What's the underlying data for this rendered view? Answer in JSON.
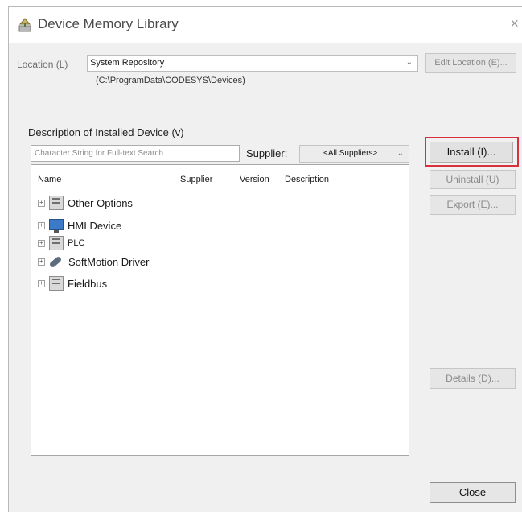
{
  "window": {
    "title": "Device Memory Library",
    "close_glyph": "×"
  },
  "location": {
    "label": "Location (L)",
    "value": "System Repository",
    "path": "(C:\\ProgramData\\CODESYS\\Devices)",
    "edit_button": "Edit Location (E)..."
  },
  "installed": {
    "label": "Description of Installed Device (v)",
    "search_placeholder": "Character String for Full-text Search",
    "supplier_label": "Supplier:",
    "supplier_value": "<All Suppliers>"
  },
  "columns": [
    "Name",
    "Supplier",
    "Version",
    "Description"
  ],
  "tree": [
    {
      "label": "Other Options",
      "icon": "cabinet-icon"
    },
    {
      "label": "HMI Device",
      "icon": "monitor-icon"
    },
    {
      "label": "PLC",
      "icon": "cabinet-icon"
    },
    {
      "label": "SoftMotion Driver",
      "icon": "drive-icon"
    },
    {
      "label": "Fieldbus",
      "icon": "cabinet-icon"
    }
  ],
  "buttons": {
    "install": "Install (I)...",
    "uninstall": "Uninstall (U)",
    "export": "Export (E)...",
    "details": "Details (D)...",
    "close": "Close"
  },
  "colors": {
    "highlight": "#d9313b",
    "disabled_text": "#8a8a8a"
  }
}
